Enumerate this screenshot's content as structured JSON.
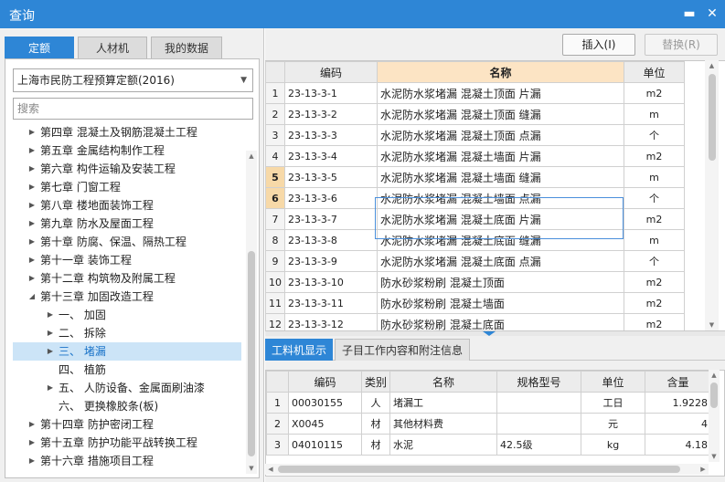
{
  "window": {
    "title": "查询",
    "minimize_icon": "minimize-icon",
    "maximize_icon": "maximize-icon",
    "close_icon": "close-icon",
    "accent": "#2e86d6"
  },
  "left": {
    "tabs": [
      {
        "label": "定额",
        "active": true
      },
      {
        "label": "人材机",
        "active": false
      },
      {
        "label": "我的数据",
        "active": false
      }
    ],
    "quota_select": "上海市民防工程预算定额(2016)",
    "search_placeholder": "搜索",
    "tree": [
      {
        "label": "第四章 混凝土及钢筋混凝土工程",
        "level": 0,
        "arrow": "right"
      },
      {
        "label": "第五章 金属结构制作工程",
        "level": 0,
        "arrow": "right"
      },
      {
        "label": "第六章 构件运输及安装工程",
        "level": 0,
        "arrow": "right"
      },
      {
        "label": "第七章 门窗工程",
        "level": 0,
        "arrow": "right"
      },
      {
        "label": "第八章 楼地面装饰工程",
        "level": 0,
        "arrow": "right"
      },
      {
        "label": "第九章 防水及屋面工程",
        "level": 0,
        "arrow": "right"
      },
      {
        "label": "第十章 防腐、保温、隔热工程",
        "level": 0,
        "arrow": "right"
      },
      {
        "label": "第十一章 装饰工程",
        "level": 0,
        "arrow": "right"
      },
      {
        "label": "第十二章 构筑物及附属工程",
        "level": 0,
        "arrow": "right"
      },
      {
        "label": "第十三章 加固改造工程",
        "level": 0,
        "arrow": "down"
      },
      {
        "label": "一、 加固",
        "level": 1,
        "arrow": "right"
      },
      {
        "label": "二、 拆除",
        "level": 1,
        "arrow": "right"
      },
      {
        "label": "三、 堵漏",
        "level": 1,
        "arrow": "right",
        "selected": true
      },
      {
        "label": "四、 植筋",
        "level": 1,
        "arrow": "none"
      },
      {
        "label": "五、 人防设备、金属面刷油漆",
        "level": 1,
        "arrow": "right"
      },
      {
        "label": "六、 更换橡胶条(板)",
        "level": 1,
        "arrow": "none"
      },
      {
        "label": "第十四章 防护密闭工程",
        "level": 0,
        "arrow": "right"
      },
      {
        "label": "第十五章 防护功能平战转换工程",
        "level": 0,
        "arrow": "right"
      },
      {
        "label": "第十六章 措施项目工程",
        "level": 0,
        "arrow": "right"
      }
    ]
  },
  "toolbar": {
    "insert_label": "插入(I)",
    "replace_label": "替换(R)"
  },
  "grid": {
    "headers": [
      "编码",
      "名称",
      "单位"
    ],
    "rows": [
      {
        "idx": "1",
        "code": "23-13-3-1",
        "name": "水泥防水浆堵漏 混凝土顶面 片漏",
        "unit": "m2"
      },
      {
        "idx": "2",
        "code": "23-13-3-2",
        "name": "水泥防水浆堵漏 混凝土顶面 缝漏",
        "unit": "m"
      },
      {
        "idx": "3",
        "code": "23-13-3-3",
        "name": "水泥防水浆堵漏 混凝土顶面 点漏",
        "unit": "个"
      },
      {
        "idx": "4",
        "code": "23-13-3-4",
        "name": "水泥防水浆堵漏 混凝土墙面 片漏",
        "unit": "m2"
      },
      {
        "idx": "5",
        "code": "23-13-3-5",
        "name": "水泥防水浆堵漏 混凝土墙面 缝漏",
        "unit": "m",
        "selected": true
      },
      {
        "idx": "6",
        "code": "23-13-3-6",
        "name": "水泥防水浆堵漏 混凝土墙面 点漏",
        "unit": "个",
        "selected": true
      },
      {
        "idx": "7",
        "code": "23-13-3-7",
        "name": "水泥防水浆堵漏 混凝土底面 片漏",
        "unit": "m2"
      },
      {
        "idx": "8",
        "code": "23-13-3-8",
        "name": "水泥防水浆堵漏 混凝土底面 缝漏",
        "unit": "m"
      },
      {
        "idx": "9",
        "code": "23-13-3-9",
        "name": "水泥防水浆堵漏 混凝土底面 点漏",
        "unit": "个"
      },
      {
        "idx": "10",
        "code": "23-13-3-10",
        "name": "防水砂浆粉刷 混凝土顶面",
        "unit": "m2"
      },
      {
        "idx": "11",
        "code": "23-13-3-11",
        "name": "防水砂浆粉刷 混凝土墙面",
        "unit": "m2"
      },
      {
        "idx": "12",
        "code": "23-13-3-12",
        "name": "防水砂浆粉刷 混凝土底面",
        "unit": "m2"
      }
    ]
  },
  "bottom": {
    "tabs": [
      {
        "label": "工料机显示",
        "active": true
      },
      {
        "label": "子目工作内容和附注信息",
        "active": false
      }
    ],
    "headers": [
      "编码",
      "类别",
      "名称",
      "规格型号",
      "单位",
      "含量"
    ],
    "rows": [
      {
        "idx": "1",
        "code": "00030155",
        "type": "人",
        "name": "堵漏工",
        "spec": "",
        "unit": "工日",
        "qty": "1.9228"
      },
      {
        "idx": "2",
        "code": "X0045",
        "type": "材",
        "name": "其他材料费",
        "spec": "",
        "unit": "元",
        "qty": "4"
      },
      {
        "idx": "3",
        "code": "04010115",
        "type": "材",
        "name": "水泥",
        "spec": "42.5级",
        "unit": "kg",
        "qty": "4.18"
      }
    ]
  }
}
